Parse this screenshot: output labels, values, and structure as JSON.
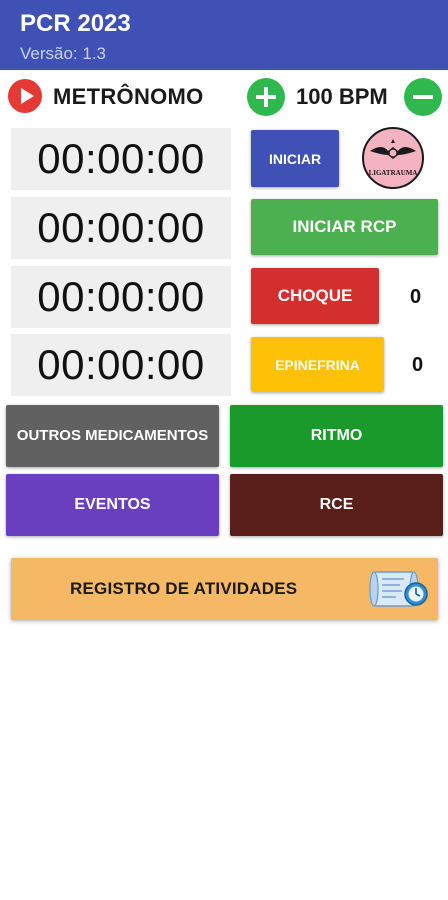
{
  "app": {
    "title": "PCR 2023",
    "version": "Versão: 1.3",
    "colors": {
      "appbar": "#3f51b5",
      "accent_green": "#2eb84d",
      "play_red": "#e53935"
    }
  },
  "metronome": {
    "play_icon": "play-icon",
    "label": "METRÔNOMO",
    "plus_icon": "plus-icon",
    "bpm": "100 BPM",
    "minus_icon": "minus-icon"
  },
  "timers": [
    "00:00:00",
    "00:00:00",
    "00:00:00",
    "00:00:00"
  ],
  "actions": {
    "iniciar": "INICIAR",
    "iniciar_rcp": "INICIAR RCP",
    "choque": "CHOQUE",
    "choque_count": "0",
    "epinefrina": "EPINEFRINA",
    "epinefrina_count": "0",
    "logo_text": "LIGATRAUMA"
  },
  "grid": {
    "outros_medicamentos": "OUTROS MEDICAMENTOS",
    "ritmo": "RITMO",
    "eventos": "EVENTOS",
    "rce": "RCE"
  },
  "registro": {
    "label": "REGISTRO DE ATIVIDADES",
    "icon": "scroll-clock-icon"
  }
}
